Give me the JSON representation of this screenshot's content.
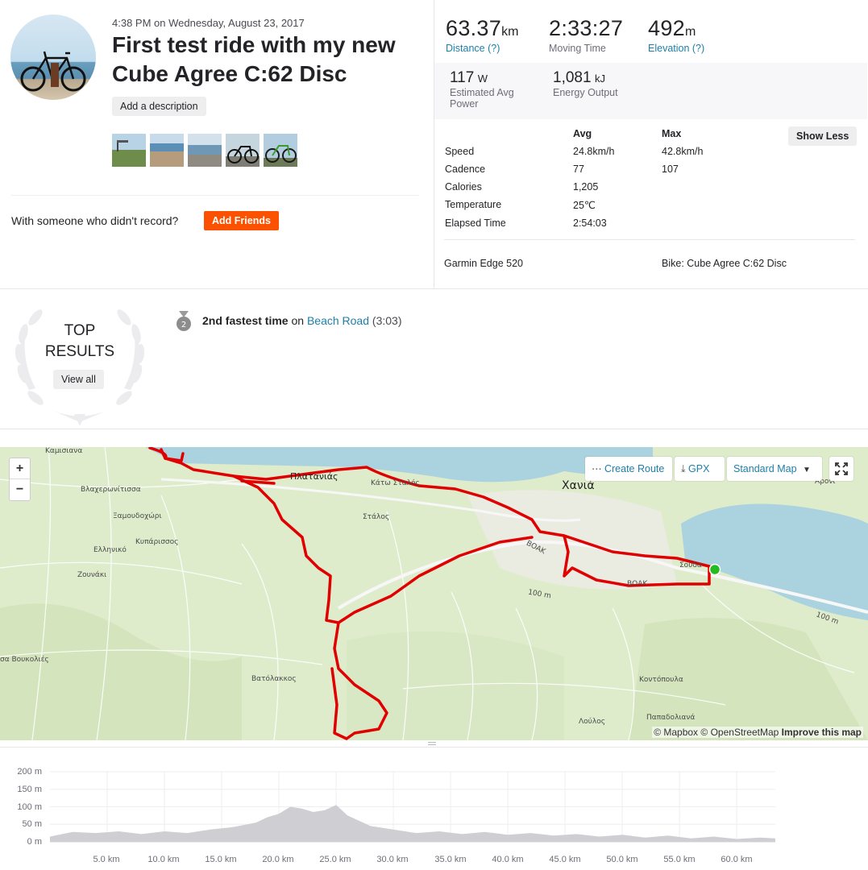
{
  "activity": {
    "datetime": "4:38 PM on Wednesday, August 23, 2017",
    "title": "First test ride with my new Cube Agree C:62 Disc",
    "add_description": "Add a description",
    "photo_count": 5,
    "with_someone": "With someone who didn't record?",
    "add_friends": "Add Friends"
  },
  "stats": {
    "distance": {
      "value": "63.37",
      "unit": "km",
      "label": "Distance (?)"
    },
    "moving_time": {
      "value": "2:33:27",
      "label": "Moving Time"
    },
    "elevation": {
      "value": "492",
      "unit": "m",
      "label": "Elevation (?)"
    },
    "power": {
      "value": "117",
      "unit": "W",
      "label": "Estimated Avg Power"
    },
    "energy": {
      "value": "1,081",
      "unit": "kJ",
      "label": "Energy Output"
    },
    "table": {
      "avg_header": "Avg",
      "max_header": "Max",
      "rows": [
        {
          "label": "Speed",
          "avg": "24.8km/h",
          "max": "42.8km/h"
        },
        {
          "label": "Cadence",
          "avg": "77",
          "max": "107"
        },
        {
          "label": "Calories",
          "avg": "1,205",
          "max": ""
        },
        {
          "label": "Temperature",
          "avg": "25℃",
          "max": ""
        },
        {
          "label": "Elapsed Time",
          "avg": "2:54:03",
          "max": ""
        }
      ]
    },
    "show_less": "Show Less",
    "device": "Garmin Edge 520",
    "bike": "Bike: Cube Agree C:62 Disc"
  },
  "top_results": {
    "label_line1": "TOP",
    "label_line2": "RESULTS",
    "view_all": "View all",
    "medal_rank": "2",
    "achievement_bold": "2nd fastest time",
    "achievement_on": "on",
    "segment": "Beach Road",
    "segment_time": "(3:03)"
  },
  "map": {
    "zoom_in": "+",
    "zoom_out": "−",
    "create_route": "Create Route",
    "gpx": "GPX",
    "map_type": "Standard Map",
    "attribution_mapbox": "© Mapbox",
    "attribution_osm": "© OpenStreetMap",
    "improve": "Improve this map",
    "place_labels": [
      {
        "id": "kamisiana",
        "text": "Καμισιανα"
      },
      {
        "id": "platanias",
        "text": "Πλατανιάς"
      },
      {
        "id": "kato_stalos",
        "text": "Κάτω Σταλός"
      },
      {
        "id": "chania",
        "text": "Χανιά"
      },
      {
        "id": "aroni",
        "text": "Αρονι"
      },
      {
        "id": "vlacheronitissa",
        "text": "Βλαχερωνίτισσα"
      },
      {
        "id": "xamoudochori",
        "text": "Ξαμουδοχώρι"
      },
      {
        "id": "stalos",
        "text": "Στάλος"
      },
      {
        "id": "kyparissos",
        "text": "Κυπάρισσος"
      },
      {
        "id": "elliniko",
        "text": "Ελληνικό"
      },
      {
        "id": "vok1",
        "text": "ΒΟΑΚ"
      },
      {
        "id": "souda",
        "text": "Σούδα"
      },
      {
        "id": "zounaki",
        "text": "Ζουνάκι"
      },
      {
        "id": "vok2",
        "text": "ΒΟΑΚ"
      },
      {
        "id": "m100a",
        "text": "100 m"
      },
      {
        "id": "m100b",
        "text": "100 m"
      },
      {
        "id": "voukolies",
        "text": "σα Βουκολιές"
      },
      {
        "id": "vatolakkos",
        "text": "Βατόλακκος"
      },
      {
        "id": "kontopoula",
        "text": "Κοντόπουλα"
      },
      {
        "id": "papadoliana",
        "text": "Παπαδολιανά"
      },
      {
        "id": "lolos",
        "text": "Λούλος"
      }
    ]
  },
  "elevation_chart": {
    "y_ticks": [
      "200 m",
      "150 m",
      "100 m",
      "50 m",
      "0 m"
    ],
    "x_ticks": [
      "5.0 km",
      "10.0 km",
      "15.0 km",
      "20.0 km",
      "25.0 km",
      "30.0 km",
      "35.0 km",
      "40.0 km",
      "45.0 km",
      "50.0 km",
      "55.0 km",
      "60.0 km"
    ]
  },
  "chart_data": {
    "type": "area",
    "x": [
      0,
      2,
      4,
      6,
      8,
      10,
      12,
      14,
      16,
      18,
      19,
      20,
      21,
      22,
      23,
      24,
      25,
      26,
      27,
      28,
      30,
      32,
      34,
      36,
      38,
      40,
      42,
      44,
      46,
      48,
      50,
      52,
      54,
      56,
      58,
      60,
      62,
      63.37
    ],
    "y": [
      15,
      28,
      25,
      30,
      22,
      30,
      25,
      35,
      42,
      55,
      70,
      80,
      100,
      95,
      85,
      90,
      105,
      75,
      60,
      45,
      35,
      25,
      30,
      22,
      28,
      20,
      25,
      18,
      22,
      15,
      20,
      12,
      18,
      10,
      15,
      8,
      12,
      10
    ],
    "xlabel": "",
    "ylabel": "",
    "xlim": [
      0,
      63.37
    ],
    "ylim": [
      0,
      200
    ],
    "y_ticks": [
      0,
      50,
      100,
      150,
      200
    ],
    "x_ticks": [
      5,
      10,
      15,
      20,
      25,
      30,
      35,
      40,
      45,
      50,
      55,
      60
    ],
    "grid": true,
    "colors": {
      "fill": "#cfcfd3",
      "grid": "#eeeeef"
    }
  },
  "colors": {
    "brand": "#fc5200",
    "link": "#1d7fa8",
    "route": "#e00000",
    "start": "#22bb22"
  }
}
